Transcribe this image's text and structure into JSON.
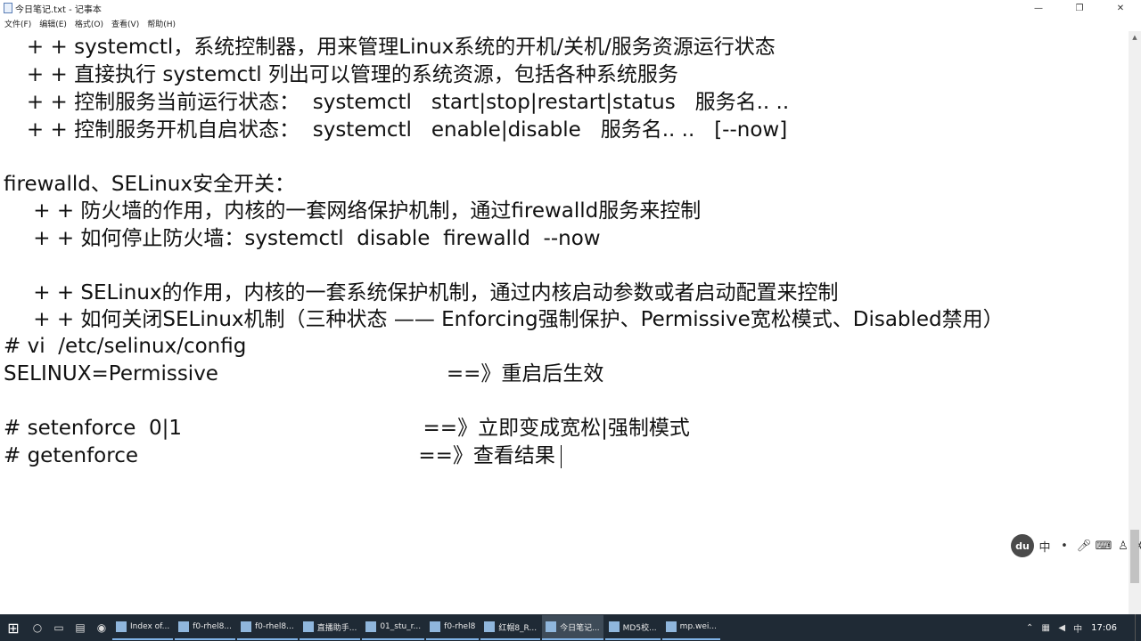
{
  "window": {
    "title": "今日笔记.txt - 记事本",
    "controls": {
      "minimize": "—",
      "maximize": "❐",
      "close": "✕"
    }
  },
  "menu": [
    "文件(F)",
    "编辑(E)",
    "格式(O)",
    "查看(V)",
    "帮助(H)"
  ],
  "editor": {
    "lines": [
      "   + + systemctl，系统控制器，用来管理Linux系统的开机/关机/服务资源运行状态",
      "   + + 直接执行 systemctl 列出可以管理的系统资源，包括各种系统服务",
      "   + + 控制服务当前运行状态：  systemctl   start|stop|restart|status   服务名.. ..",
      "   + + 控制服务开机自启状态：  systemctl   enable|disable   服务名.. ..   [--now]",
      "",
      "firewalld、SELinux安全开关：",
      "    + + 防火墙的作用，内核的一套网络保护机制，通过firewalld服务来控制",
      "    + + 如何停止防火墙：systemctl  disable  firewalld  --now",
      "",
      "    + + SELinux的作用，内核的一套系统保护机制，通过内核启动参数或者启动配置来控制",
      "    + + 如何关闭SELinux机制（三种状态 —— Enforcing强制保护、Permissive宽松模式、Disabled禁用）",
      "# vi  /etc/selinux/config",
      "SELINUX=Permissive                                   ==》重启后生效",
      "",
      "# setenforce  0|1                                     ==》立即变成宽松|强制模式",
      "# getenforce                                           ==》查看结果"
    ]
  },
  "ime": {
    "logo": "du",
    "lang": "中",
    "icons": [
      "dot-icon",
      "mic-icon",
      "keyboard-icon",
      "skin-icon",
      "settings-icon"
    ]
  },
  "taskbar": {
    "start_icon": "⊞",
    "tasks": [
      {
        "label": "Index of...",
        "active": false
      },
      {
        "label": "f0-rhel8...",
        "active": false
      },
      {
        "label": "f0-rhel8...",
        "active": false
      },
      {
        "label": "直播助手...",
        "active": false
      },
      {
        "label": "01_stu_r...",
        "active": false
      },
      {
        "label": "f0-rhel8",
        "active": false
      },
      {
        "label": "红帽8_R...",
        "active": false
      },
      {
        "label": "今日笔记...",
        "active": true
      },
      {
        "label": "MD5校...",
        "active": false
      },
      {
        "label": "mp.wei...",
        "active": false
      }
    ],
    "clock": "17:06"
  }
}
